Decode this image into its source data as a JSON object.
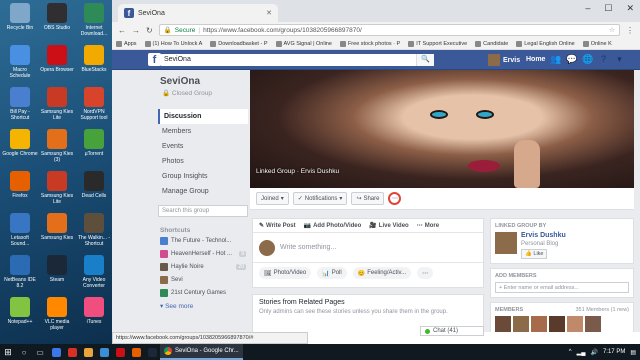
{
  "desktop": {
    "icons": [
      {
        "label": "Recycle Bin",
        "color": "#7fa7c9"
      },
      {
        "label": "OBS Studio",
        "color": "#302e31"
      },
      {
        "label": "Internet Download...",
        "color": "#2e8b57"
      },
      {
        "label": "Macro Schedule",
        "color": "#4a90e2"
      },
      {
        "label": "Opera Browser",
        "color": "#cc0f16"
      },
      {
        "label": "BlueStacks",
        "color": "#f2a900"
      },
      {
        "label": "Bill Pay - Shortcut",
        "color": "#4a7fd0"
      },
      {
        "label": "Samsung Kies Lite",
        "color": "#c93a25"
      },
      {
        "label": "NordVPN Support tool",
        "color": "#d7442b"
      },
      {
        "label": "Google Chrome",
        "color": "#f4b400"
      },
      {
        "label": "Samsung Kies (3)",
        "color": "#e46f1b"
      },
      {
        "label": "µTorrent",
        "color": "#48a23b"
      },
      {
        "label": "Firefox",
        "color": "#e66000"
      },
      {
        "label": "Samsung Kies Lite",
        "color": "#c93a25"
      },
      {
        "label": "Dead Cells",
        "color": "#2a2a2a"
      },
      {
        "label": "Letasoft Sound...",
        "color": "#3875c3"
      },
      {
        "label": "Samsung Kies",
        "color": "#e46f1b"
      },
      {
        "label": "The Walkin... - Shortcut",
        "color": "#5d4f3c"
      },
      {
        "label": "NetBeans IDE 8.2",
        "color": "#2a6bb3"
      },
      {
        "label": "Steam",
        "color": "#1b2838"
      },
      {
        "label": "Any Video Converter",
        "color": "#1a7fc9"
      },
      {
        "label": "Notepad++",
        "color": "#82c341"
      },
      {
        "label": "VLC media player",
        "color": "#ff8800"
      },
      {
        "label": "iTunes",
        "color": "#f04e7f"
      }
    ]
  },
  "browser": {
    "tab_title": "SeviOna",
    "url_secure": "Secure",
    "url": "https://www.facebook.com/groups/1038205966897870/",
    "bookmarks": [
      "Apps",
      "(1) How To Unlock A",
      "Downloadbasket - P",
      "AVG Signal | Online",
      "Free stock photos · P",
      "IT Support Executive",
      "Candidate",
      "Legal English Online",
      "Online K"
    ],
    "status_url": "https://www.facebook.com/groups/1038205966897870/#"
  },
  "fb_header": {
    "logo": "f",
    "search_value": "SeviOna",
    "user_name": "Ervis",
    "home_label": "Home"
  },
  "group": {
    "name": "SeviOna",
    "privacy": "Closed Group",
    "nav": [
      "Discussion",
      "Members",
      "Events",
      "Photos",
      "Group Insights",
      "Manage Group"
    ],
    "search_placeholder": "Search this group",
    "shortcuts_heading": "Shortcuts",
    "shortcuts": [
      {
        "label": "The Future - Technol...",
        "color": "#4a7fd0",
        "count": ""
      },
      {
        "label": "HeavenHerself - Hot ...",
        "color": "#d14b8f",
        "count": "9"
      },
      {
        "label": "Haylie Noire",
        "color": "#6a5a4a",
        "count": "20"
      },
      {
        "label": "Sevi",
        "color": "#8b6b4a",
        "count": ""
      },
      {
        "label": "21st Century Games",
        "color": "#2e8b57",
        "count": ""
      }
    ],
    "see_more": "See more",
    "cover_caption": "Linked Group · Ervis Dushku",
    "actions": {
      "joined": "Joined",
      "notifications": "Notifications",
      "share": "Share",
      "more": "⋯"
    },
    "composer": {
      "tabs": [
        "Write Post",
        "Add Photo/Video",
        "Live Video",
        "More"
      ],
      "placeholder": "Write something...",
      "options": [
        "Photo/Video",
        "Poll",
        "Feeling/Activ..."
      ]
    },
    "stories": {
      "title": "Stories from Related Pages",
      "subtitle": "Only admins can see these stories unless you share them in the group."
    }
  },
  "right_col": {
    "linked_heading": "LINKED GROUP BY",
    "linked_name": "Ervis Dushku",
    "linked_desc": "Personal Blog",
    "linked_like": "Like",
    "add_members_heading": "ADD MEMBERS",
    "add_members_placeholder": "Enter name or email address...",
    "members_heading": "MEMBERS",
    "members_count": "351 Members (1 new)",
    "member_colors": [
      "#6b4a3a",
      "#8b6b4a",
      "#a56b4a",
      "#5a3a2a",
      "#c08a6a",
      "#7a5a4a"
    ]
  },
  "chat": {
    "label": "Chat (41)"
  },
  "taskbar": {
    "active_app": "SeviOna - Google Chr...",
    "time": "7:17 PM",
    "pinned_colors": [
      "#3b78e7",
      "#d93025",
      "#e8a33d",
      "#3a8fd6",
      "#cc0f16",
      "#e66000",
      "#1b2838"
    ]
  }
}
